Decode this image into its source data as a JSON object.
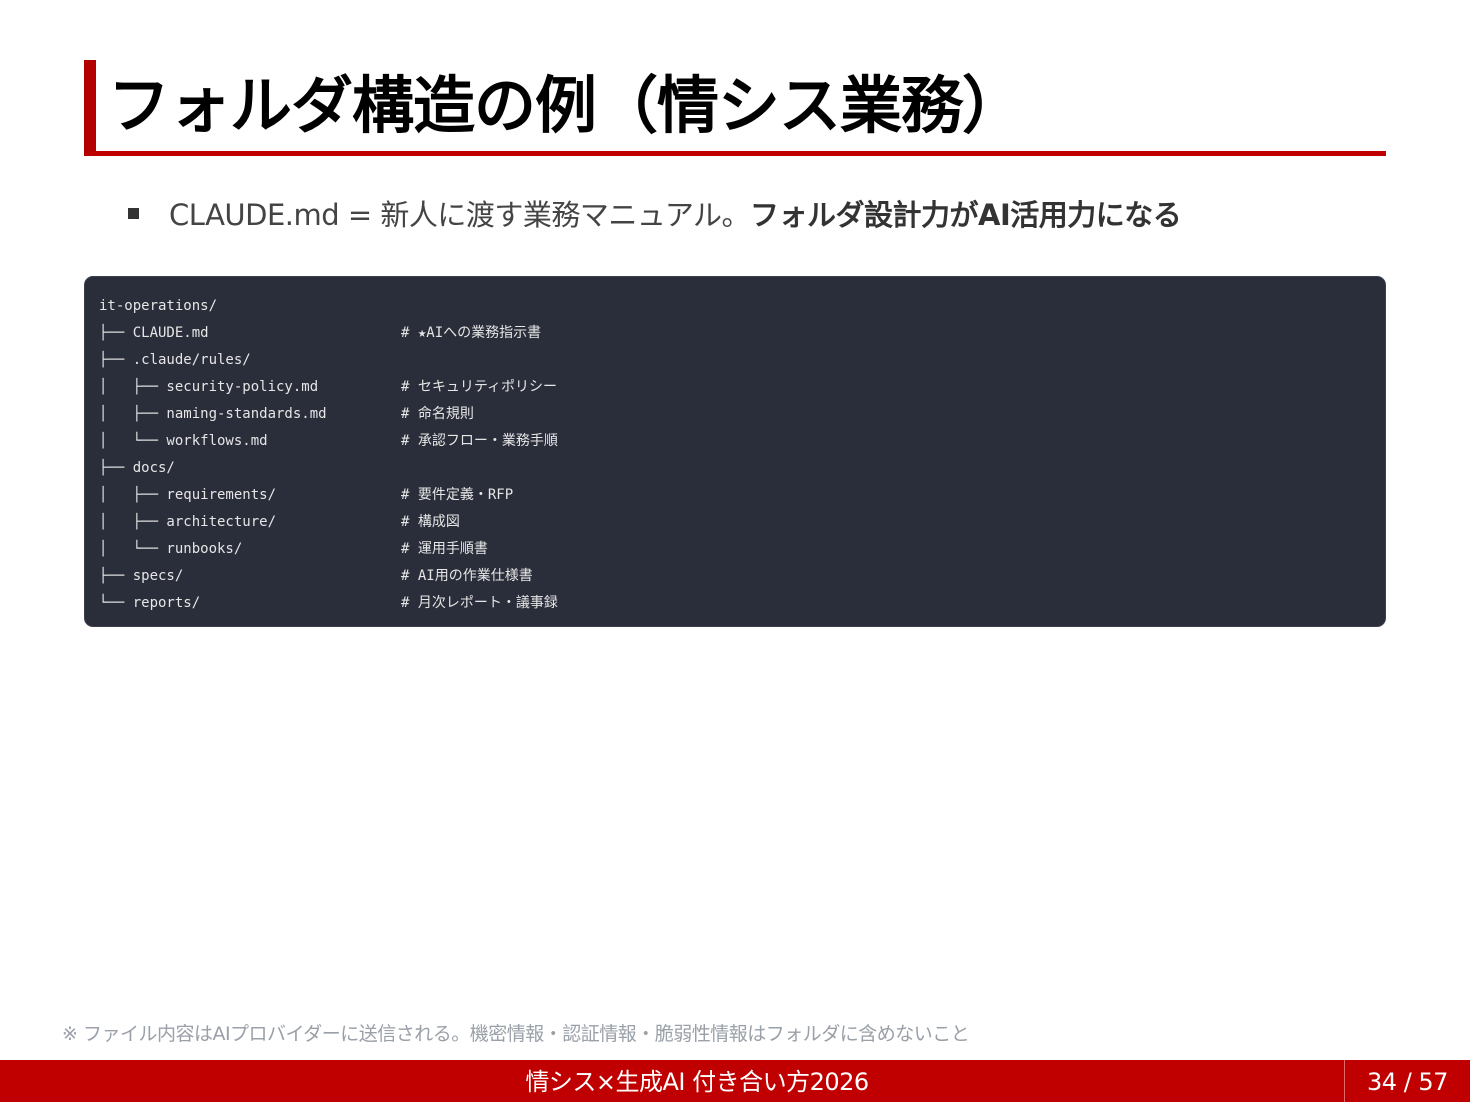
{
  "slide": {
    "title": "フォルダ構造の例（情シス業務）",
    "bullet": {
      "text": "CLAUDE.md = 新人に渡す業務マニュアル。",
      "strong": "フォルダ設計力がAI活用力になる"
    },
    "code": {
      "lines": [
        {
          "path": "it-operations/",
          "comment": ""
        },
        {
          "path": "├── CLAUDE.md",
          "comment": "# ★AIへの業務指示書"
        },
        {
          "path": "├── .claude/rules/",
          "comment": ""
        },
        {
          "path": "│   ├── security-policy.md",
          "comment": "# セキュリティポリシー"
        },
        {
          "path": "│   ├── naming-standards.md",
          "comment": "# 命名規則"
        },
        {
          "path": "│   └── workflows.md",
          "comment": "# 承認フロー・業務手順"
        },
        {
          "path": "├── docs/",
          "comment": ""
        },
        {
          "path": "│   ├── requirements/",
          "comment": "# 要件定義・RFP"
        },
        {
          "path": "│   ├── architecture/",
          "comment": "# 構成図"
        },
        {
          "path": "│   └── runbooks/",
          "comment": "# 運用手順書"
        },
        {
          "path": "├── specs/",
          "comment": "# AI用の作業仕様書"
        },
        {
          "path": "└── reports/",
          "comment": "# 月次レポート・議事録"
        }
      ]
    },
    "footnote": "※ ファイル内容はAIプロバイダーに送信される。機密情報・認証情報・脆弱性情報はフォルダに含めないこと"
  },
  "footer": {
    "title": "情シス×生成AI 付き合い方2026",
    "page": "34 / 57"
  },
  "colors": {
    "accent": "#c00000",
    "code_background": "#2a2d3a"
  }
}
